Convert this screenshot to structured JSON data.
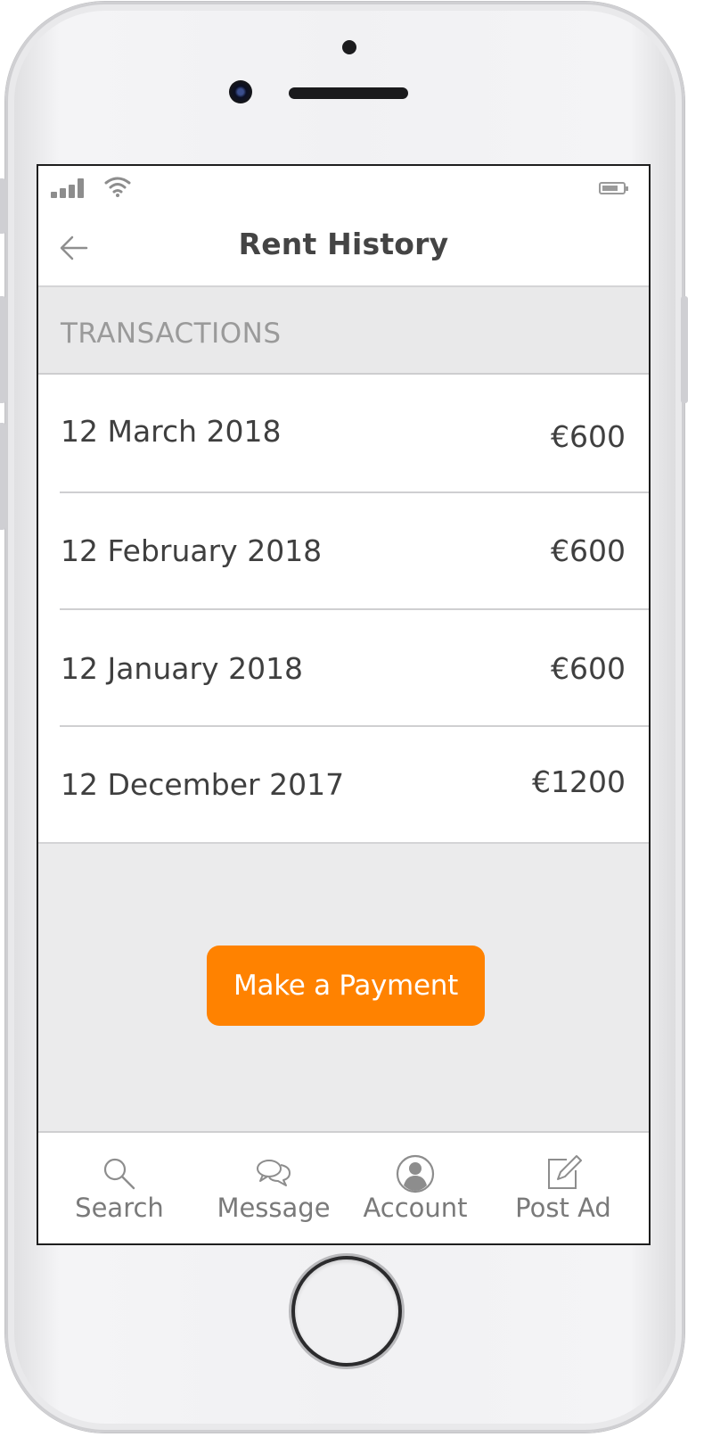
{
  "status_bar": {
    "signal_icon": "signal-bars-icon",
    "wifi_icon": "wifi-icon",
    "battery_icon": "battery-icon"
  },
  "nav": {
    "back_icon": "arrow-left-icon",
    "title": "Rent History"
  },
  "section": {
    "title": "TRANSACTIONS"
  },
  "transactions": [
    {
      "date": "12 March 2018",
      "amount": "€600"
    },
    {
      "date": "12 February 2018",
      "amount": "€600"
    },
    {
      "date": "12 January 2018",
      "amount": "€600"
    },
    {
      "date": "12 December 2017",
      "amount": "€1200"
    }
  ],
  "actions": {
    "make_payment_label": "Make a Payment"
  },
  "tab_bar": {
    "items": [
      {
        "label": "Search",
        "icon": "search-icon"
      },
      {
        "label": "Message",
        "icon": "chat-bubbles-icon"
      },
      {
        "label": "Account",
        "icon": "user-avatar-icon"
      },
      {
        "label": "Post Ad",
        "icon": "edit-icon"
      }
    ]
  },
  "colors": {
    "accent": "#ff8200",
    "text": "#3f3f3f",
    "muted": "#9a9a9a",
    "background": "#ebebec"
  }
}
